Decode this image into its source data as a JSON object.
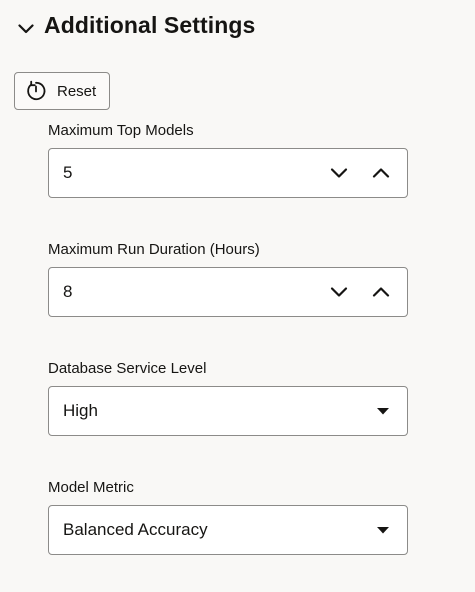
{
  "section": {
    "title": "Additional Settings",
    "toggle_icon": "chevron-down-icon"
  },
  "reset_button": {
    "label": "Reset",
    "icon": "reset-icon"
  },
  "fields": {
    "max_top_models": {
      "label": "Maximum Top Models",
      "value": "5",
      "type": "number"
    },
    "max_run_duration": {
      "label": "Maximum Run Duration (Hours)",
      "value": "8",
      "type": "number"
    },
    "db_service_level": {
      "label": "Database Service Level",
      "value": "High",
      "type": "select"
    },
    "model_metric": {
      "label": "Model Metric",
      "value": "Balanced Accuracy",
      "type": "select"
    }
  },
  "colors": {
    "background": "#f9f8f6",
    "border": "#8c8b89",
    "text": "#161513",
    "field_bg": "#ffffff"
  }
}
